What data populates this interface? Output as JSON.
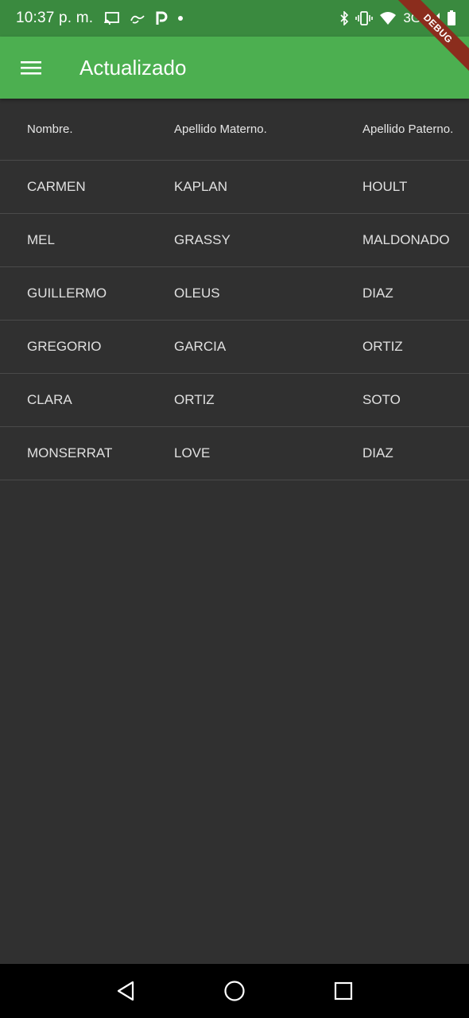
{
  "status_bar": {
    "time": "10:37 p. m.",
    "network": "3G",
    "left_icons": [
      "cast-icon",
      "link-icon",
      "parking-icon",
      "dot-icon"
    ],
    "right_icons": [
      "bluetooth-icon",
      "vibrate-icon",
      "wifi-icon",
      "signal-icon",
      "battery-icon"
    ]
  },
  "app_bar": {
    "title": "Actualizado",
    "menu_icon": "hamburger-menu-icon"
  },
  "debug_banner": {
    "label": "DEBUG"
  },
  "table": {
    "headers": [
      "Nombre.",
      "Apellido Materno.",
      "Apellido Paterno."
    ],
    "rows": [
      [
        "CARMEN",
        "KAPLAN",
        "HOULT"
      ],
      [
        "MEL",
        "GRASSY",
        "MALDONADO"
      ],
      [
        "GUILLERMO",
        "OLEUS",
        "DIAZ"
      ],
      [
        "GREGORIO",
        "GARCIA",
        "ORTIZ"
      ],
      [
        "CLARA",
        "ORTIZ",
        "SOTO"
      ],
      [
        "MONSERRAT",
        "LOVE",
        "DIAZ"
      ]
    ]
  },
  "nav_bar": {
    "buttons": [
      "back-icon",
      "home-icon",
      "recents-icon"
    ]
  },
  "colors": {
    "app_bar": "#4caf50",
    "status_bar": "#3a8a3f",
    "background": "#303030",
    "nav_bar": "#000000",
    "debug_ribbon": "#8b2d1d"
  }
}
